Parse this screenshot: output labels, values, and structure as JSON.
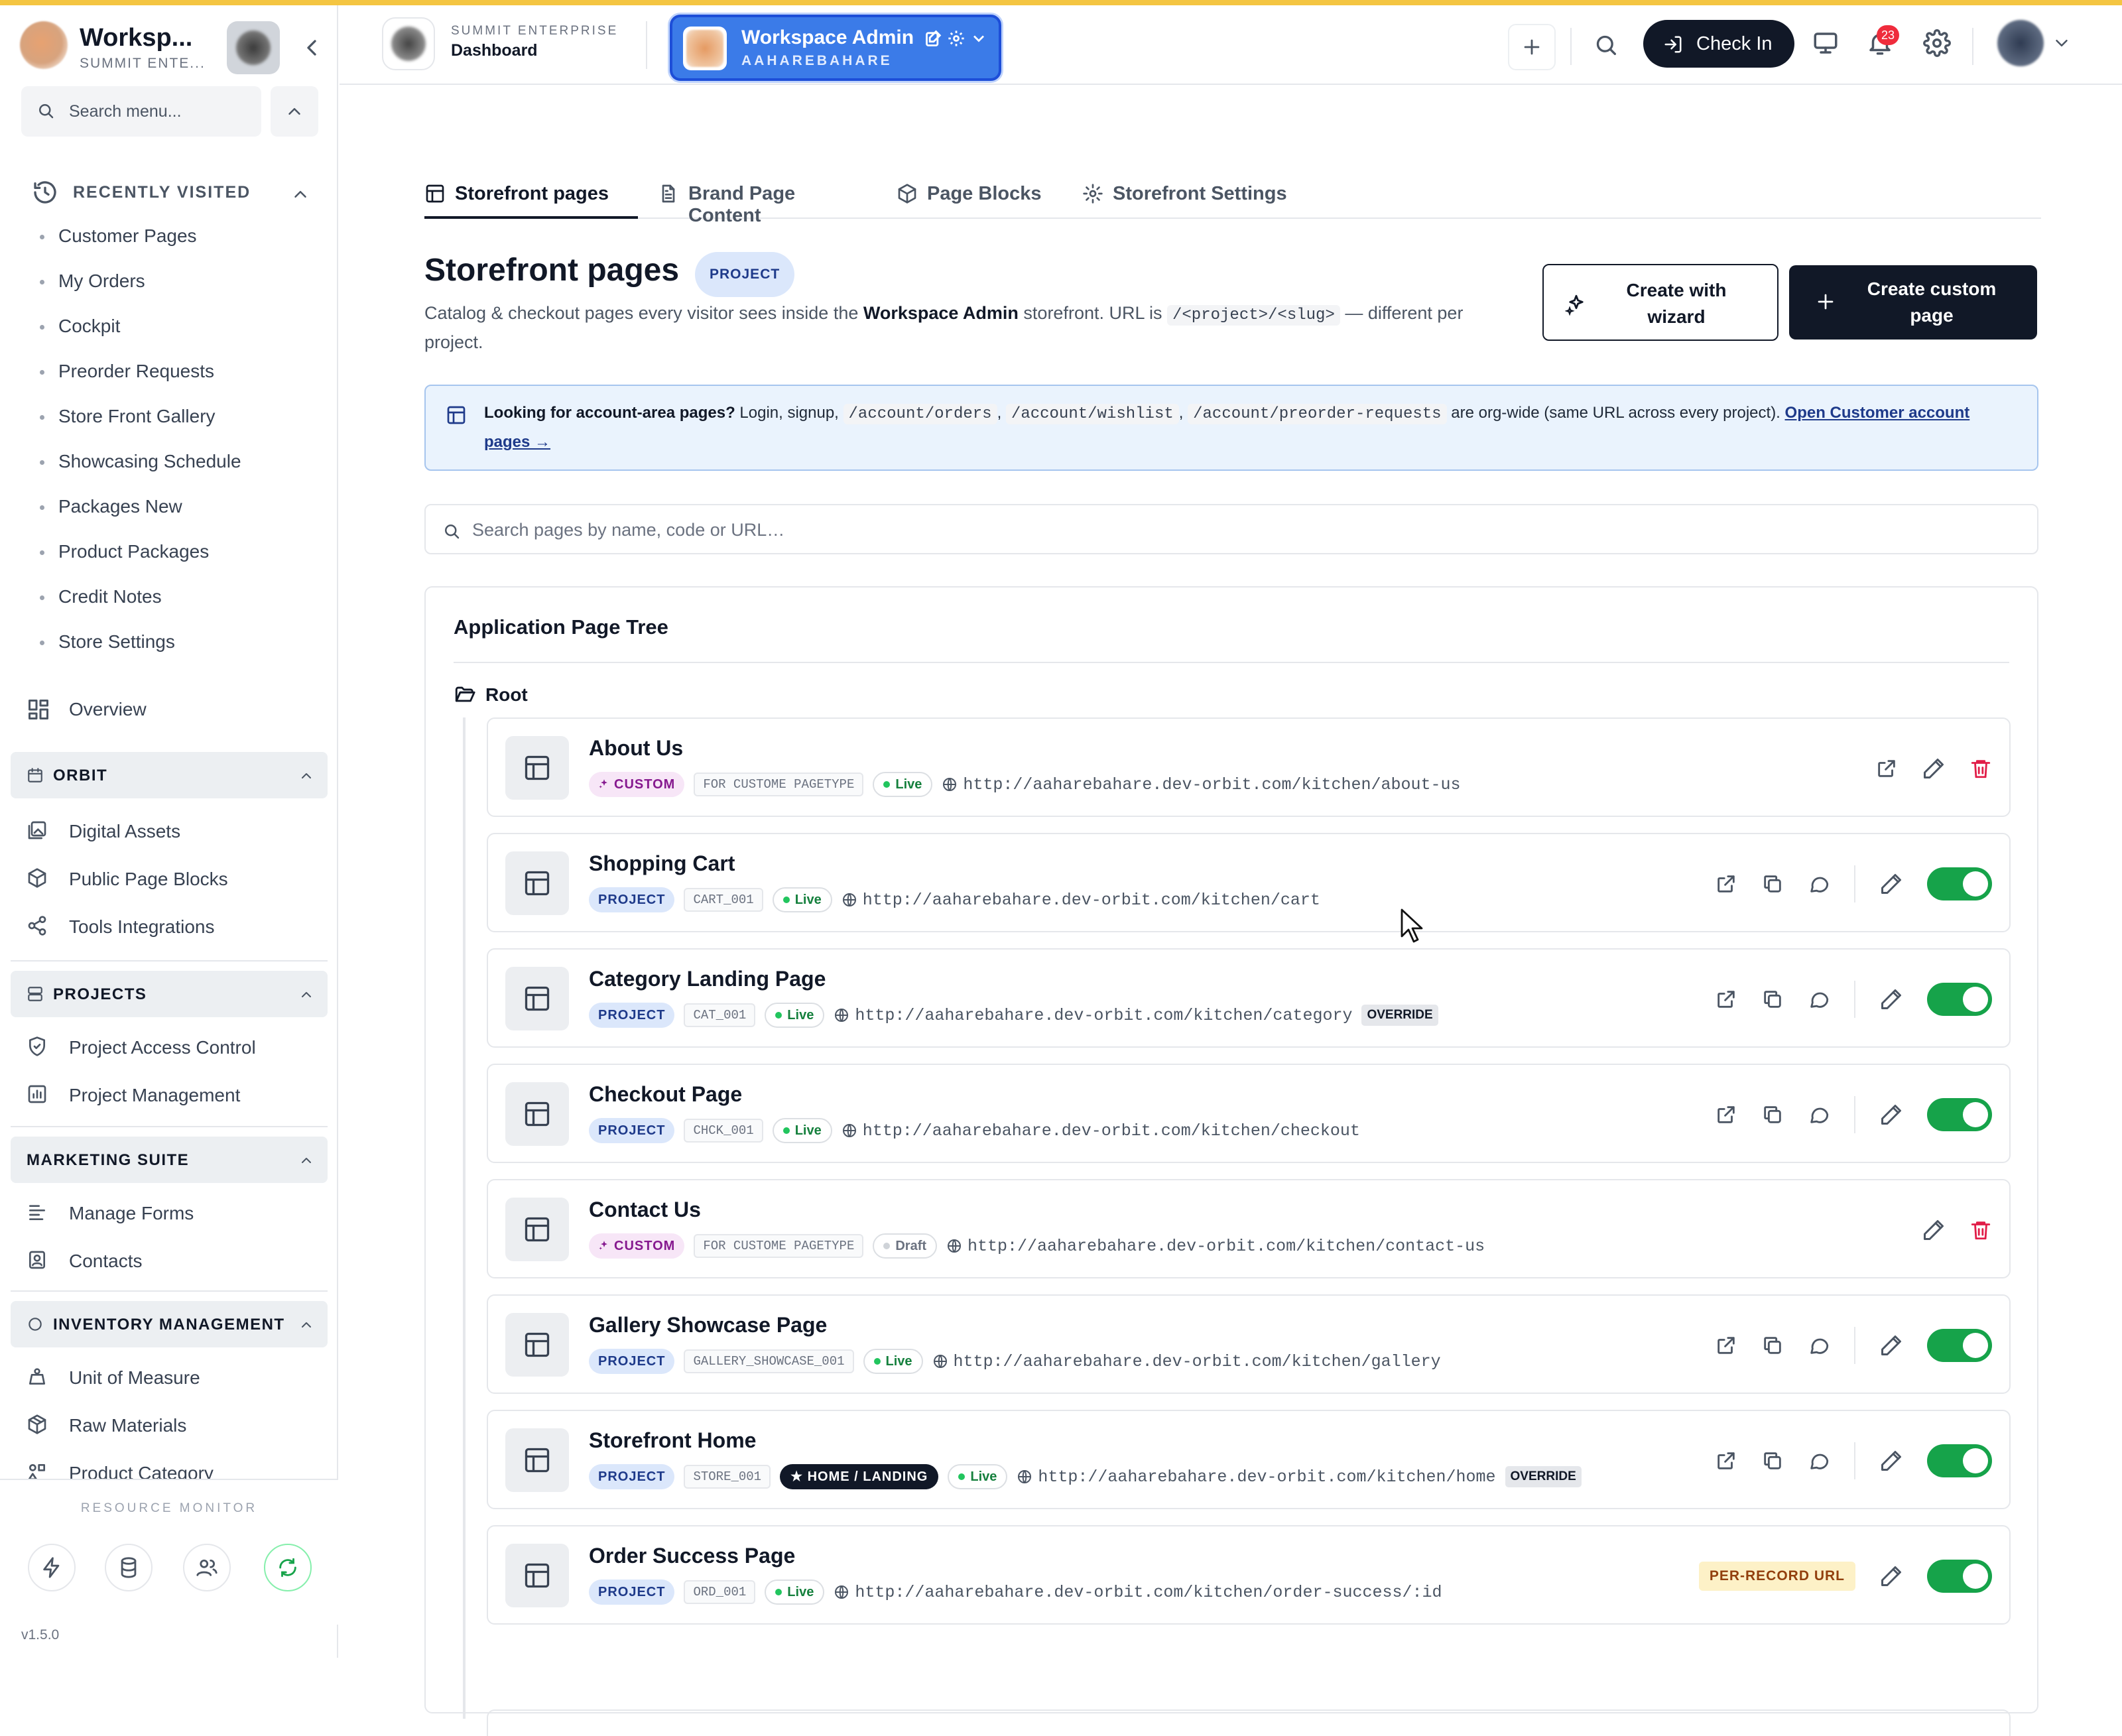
{
  "sidebar": {
    "app_title": "Worksp...",
    "app_subtitle": "SUMMIT ENTE...",
    "search_placeholder": "Search menu...",
    "recent_label": "RECENTLY VISITED",
    "recent": [
      "Customer Pages",
      "My Orders",
      "Cockpit",
      "Preorder Requests",
      "Store Front Gallery",
      "Showcasing Schedule",
      "Packages New",
      "Product Packages",
      "Credit Notes",
      "Store Settings"
    ],
    "overview": "Overview",
    "groups": {
      "orbit": {
        "label": "ORBIT",
        "items": [
          "Digital Assets",
          "Public Page Blocks",
          "Tools Integrations"
        ]
      },
      "projects": {
        "label": "PROJECTS",
        "items": [
          "Project Access Control",
          "Project Management"
        ]
      },
      "marketing": {
        "label": "MARKETING SUITE",
        "items": [
          "Manage Forms",
          "Contacts"
        ]
      },
      "inventory": {
        "label": "INVENTORY MANAGEMENT",
        "items": [
          "Unit of Measure",
          "Raw Materials",
          "Product Category"
        ]
      }
    },
    "resource_monitor": "RESOURCE MONITOR",
    "version": "v1.5.0"
  },
  "topbar": {
    "org": "SUMMIT ENTERPRISE",
    "page": "Dashboard",
    "workspace_name": "Workspace Admin",
    "workspace_code": "AAHAREBAHARE",
    "checkin": "Check In",
    "notifications": "23"
  },
  "tabs": [
    "Storefront pages",
    "Brand Page Content",
    "Page Blocks",
    "Storefront Settings"
  ],
  "page": {
    "title": "Storefront pages",
    "title_badge": "PROJECT",
    "desc_1": "Catalog & checkout pages every visitor sees inside the ",
    "desc_bold": "Workspace Admin",
    "desc_2": " storefront. URL is ",
    "desc_code": "/<project>/<slug>",
    "desc_3": " — different per project.",
    "btn_wizard": "Create with wizard",
    "btn_custom": "Create custom page"
  },
  "notice": {
    "bold": "Looking for account-area pages?",
    "text_1": " Login, signup, ",
    "code_1": "/account/orders",
    "code_2": "/account/wishlist",
    "code_3": "/account/preorder-requests",
    "text_2": " are org-wide (same URL across every project). ",
    "link": "Open Customer account pages →"
  },
  "search_pages_placeholder": "Search pages by name, code or URL…",
  "tree": {
    "title": "Application Page Tree",
    "root": "Root",
    "pages": [
      {
        "name": "About Us",
        "type": "CUSTOM",
        "code": "FOR CUSTOME PAGETYPE",
        "status": "Live",
        "url": "http://aaharebahare.dev-orbit.com/kitchen/about-us"
      },
      {
        "name": "Shopping Cart",
        "type": "PROJECT",
        "code": "CART_001",
        "status": "Live",
        "url": "http://aaharebahare.dev-orbit.com/kitchen/cart"
      },
      {
        "name": "Category Landing Page",
        "type": "PROJECT",
        "code": "CAT_001",
        "status": "Live",
        "url": "http://aaharebahare.dev-orbit.com/kitchen/category",
        "extra": "OVERRIDE"
      },
      {
        "name": "Checkout Page",
        "type": "PROJECT",
        "code": "CHCK_001",
        "status": "Live",
        "url": "http://aaharebahare.dev-orbit.com/kitchen/checkout"
      },
      {
        "name": "Contact Us",
        "type": "CUSTOM",
        "code": "FOR CUSTOME PAGETYPE",
        "status": "Draft",
        "url": "http://aaharebahare.dev-orbit.com/kitchen/contact-us"
      },
      {
        "name": "Gallery Showcase Page",
        "type": "PROJECT",
        "code": "GALLERY_SHOWCASE_001",
        "status": "Live",
        "url": "http://aaharebahare.dev-orbit.com/kitchen/gallery"
      },
      {
        "name": "Storefront Home",
        "type": "PROJECT",
        "code": "STORE_001",
        "home": "★ HOME / LANDING",
        "status": "Live",
        "url": "http://aaharebahare.dev-orbit.com/kitchen/home",
        "extra": "OVERRIDE"
      },
      {
        "name": "Order Success Page",
        "type": "PROJECT",
        "code": "ORD_001",
        "status": "Live",
        "url": "http://aaharebahare.dev-orbit.com/kitchen/order-success/:id",
        "per_record": "PER-RECORD URL"
      }
    ]
  },
  "colors": {
    "accent": "#3b7be8",
    "dark": "#111827",
    "toggle_on": "#16a34a",
    "delete": "#e11d48",
    "top_stripe": "#f4c542"
  }
}
